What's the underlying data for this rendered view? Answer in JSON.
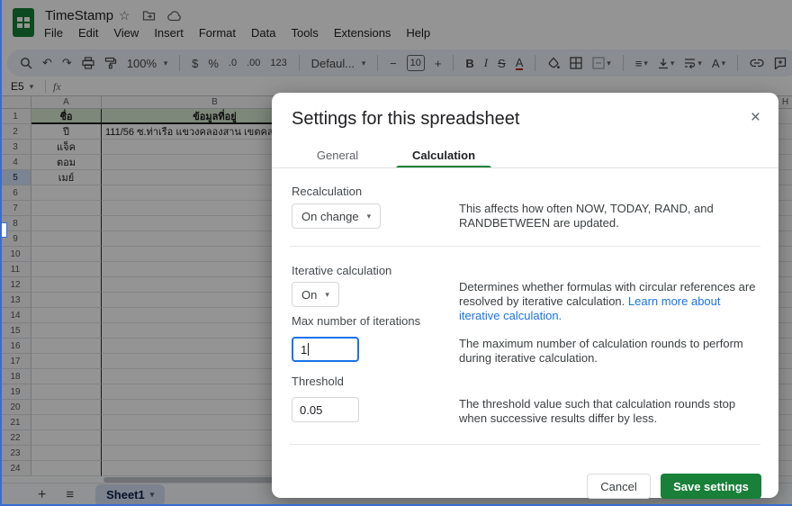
{
  "titlebar": {
    "doc_title": "TimeStamp",
    "menus": [
      "File",
      "Edit",
      "View",
      "Insert",
      "Format",
      "Data",
      "Tools",
      "Extensions",
      "Help"
    ]
  },
  "icons": {
    "star": "☆",
    "caret": "▾",
    "undo": "↶",
    "redo": "↷",
    "hamburger": "≡",
    "align_left": "≡",
    "plus": "+",
    "minus": "−",
    "close": "×"
  },
  "toolbar": {
    "zoom": "100%",
    "currency": "$",
    "percent": "%",
    "decrease_decimal": ".0",
    "increase_decimal": ".00",
    "more_formats": "123",
    "font_name": "Defaul...",
    "font_size": "10",
    "bold": "B",
    "italic": "I",
    "strikethrough": "S",
    "text_color": "A",
    "text_rotation": "A"
  },
  "formula_bar": {
    "cell_ref": "E5",
    "fx": "fx"
  },
  "grid": {
    "col_headers": [
      "A",
      "B",
      "H"
    ],
    "rows": [
      {
        "n": "1",
        "a": "ชื่อ",
        "b": "ข้อมูลที่อยู่",
        "header": true
      },
      {
        "n": "2",
        "a": "ปี",
        "b": "111/56 ซ.ท่าเรือ แขวงคลองสาน เขตคลองต"
      },
      {
        "n": "3",
        "a": "แจ็ค",
        "b": ""
      },
      {
        "n": "4",
        "a": "ตอม",
        "b": ""
      },
      {
        "n": "5",
        "a": "เมย์",
        "b": "",
        "selected": true
      },
      {
        "n": "6"
      },
      {
        "n": "7"
      },
      {
        "n": "8"
      },
      {
        "n": "9"
      },
      {
        "n": "10"
      },
      {
        "n": "11"
      },
      {
        "n": "12"
      },
      {
        "n": "13"
      },
      {
        "n": "14"
      },
      {
        "n": "15"
      },
      {
        "n": "16"
      },
      {
        "n": "17"
      },
      {
        "n": "18"
      },
      {
        "n": "19"
      },
      {
        "n": "20"
      },
      {
        "n": "21"
      },
      {
        "n": "22"
      },
      {
        "n": "23"
      },
      {
        "n": "24"
      }
    ]
  },
  "tabbar": {
    "sheet_name": "Sheet1"
  },
  "dialog": {
    "title": "Settings for this spreadsheet",
    "tabs": [
      {
        "label": "General",
        "active": false
      },
      {
        "label": "Calculation",
        "active": true
      }
    ],
    "recalculation": {
      "label": "Recalculation",
      "value": "On change",
      "description": "This affects how often NOW, TODAY, RAND, and RANDBETWEEN are updated."
    },
    "iterative": {
      "label": "Iterative calculation",
      "value": "On",
      "description": "Determines whether formulas with circular references are resolved by iterative calculation. ",
      "link_text": "Learn more about iterative calculation."
    },
    "max_iterations": {
      "label": "Max number of iterations",
      "value": "1",
      "description": "The maximum number of calculation rounds to perform during iterative calculation."
    },
    "threshold": {
      "label": "Threshold",
      "value": "0.05",
      "description": "The threshold value such that calculation rounds stop when successive results differ by less."
    },
    "buttons": {
      "cancel": "Cancel",
      "save": "Save settings"
    }
  },
  "colors": {
    "accent_green": "#188038",
    "link_blue": "#1a73e8",
    "focus_blue": "#1a73e8",
    "header_row_green": "#d9ead3",
    "selected_header_blue": "#d3e3fd",
    "save_button_green": "#188038"
  }
}
